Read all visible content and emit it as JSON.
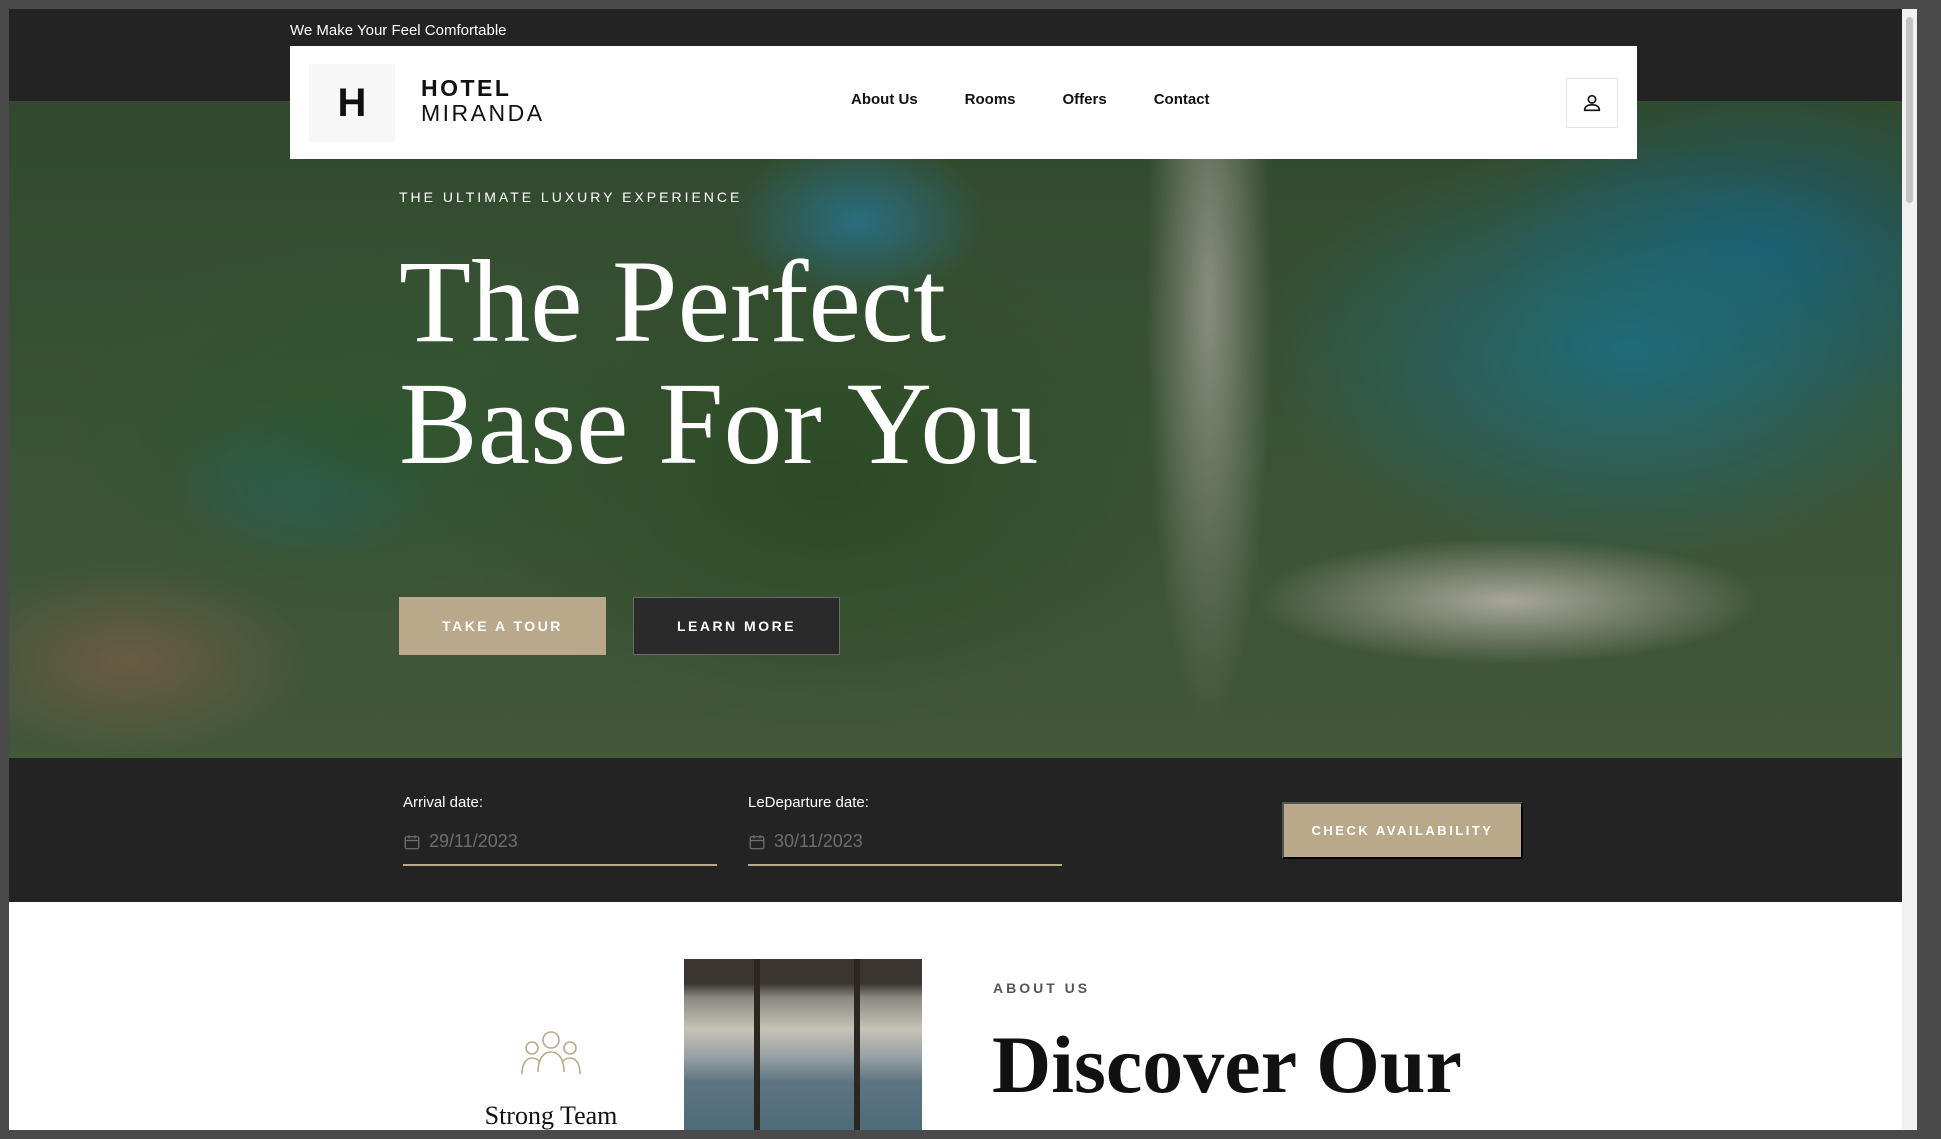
{
  "topbar": {
    "tagline": "We Make Your Feel Comfortable"
  },
  "navbar": {
    "logo_letter": "H",
    "logo_line1": "HOTEL",
    "logo_line2": "MIRANDA",
    "links": [
      "About Us",
      "Rooms",
      "Offers",
      "Contact"
    ],
    "user_icon": "user-icon"
  },
  "hero": {
    "eyebrow": "THE ULTIMATE LUXURY EXPERIENCE",
    "title_line1": "The Perfect",
    "title_line2": "Base For You",
    "tour_button": "TAKE A TOUR",
    "learn_button": "LEARN MORE"
  },
  "booking": {
    "arrival_label": "Arrival date:",
    "arrival_value": "29/11/2023",
    "departure_label": "LeDeparture date:",
    "departure_value": "30/11/2023",
    "check_button": "CHECK AVAILABILITY",
    "calendar_icon": "calendar-icon"
  },
  "about": {
    "team_label": "Strong Team",
    "team_icon": "team-icon",
    "eyebrow": "ABOUT US",
    "title_line1": "Discover Our"
  },
  "colors": {
    "accent": "#baa88a",
    "dark": "#232323",
    "white": "#ffffff"
  }
}
